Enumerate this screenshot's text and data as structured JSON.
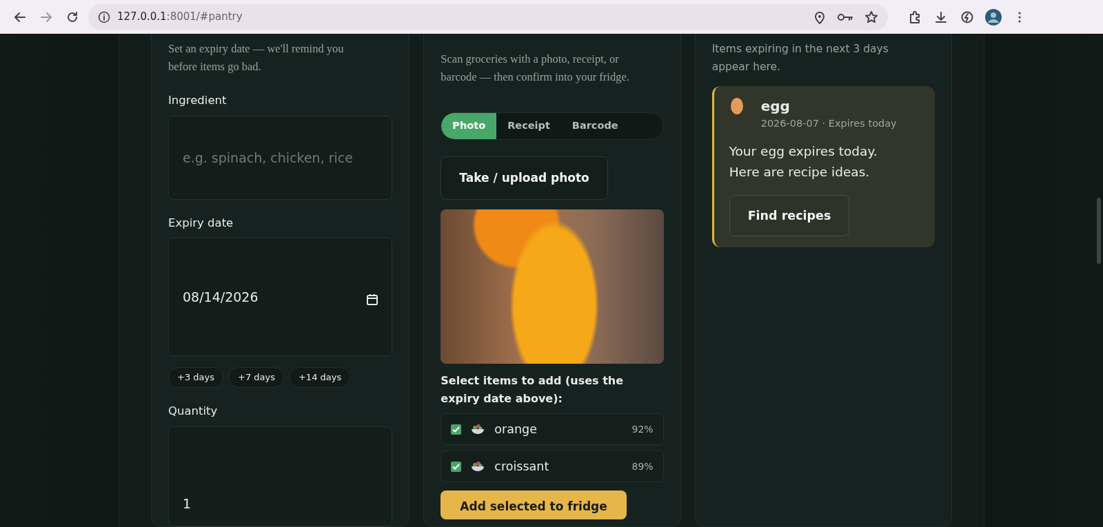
{
  "browser": {
    "url_host": "127.0.0.1",
    "url_rest": ":8001/#pantry"
  },
  "expiry_panel": {
    "description": "Set an expiry date — we'll remind you before items go bad.",
    "fields": [
      {
        "label": "Ingredient",
        "kind": "text",
        "placeholder": "e.g. spinach, chicken, rice"
      },
      {
        "label": "Expiry date",
        "kind": "date",
        "value": "08/14/2026",
        "chips": [
          "+3 days",
          "+7 days",
          "+14 days"
        ]
      },
      {
        "label": "Quantity",
        "kind": "number",
        "value": "1"
      }
    ]
  },
  "scan_panel": {
    "description": "Scan groceries with a photo, receipt, or barcode — then confirm into your fridge.",
    "tabs": [
      {
        "label": "Photo",
        "selected": true
      },
      {
        "label": "Receipt",
        "selected": false
      },
      {
        "label": "Barcode",
        "selected": false
      }
    ],
    "upload_button": "Take / upload photo",
    "select_prompt": "Select items to add (uses the expiry date above):",
    "items": [
      {
        "name": "orange",
        "confidence": "92%",
        "checked": true
      },
      {
        "name": "croissant",
        "confidence": "89%",
        "checked": true
      }
    ],
    "add_button": "Add selected to fridge"
  },
  "alerts_panel": {
    "description": "Items expiring in the next 3 days appear here.",
    "alerts": [
      {
        "name": "egg",
        "meta": "2026-08-07 · Expires today",
        "message": "Your egg expires today. Here are recipe ideas.",
        "button": "Find recipes"
      }
    ]
  }
}
